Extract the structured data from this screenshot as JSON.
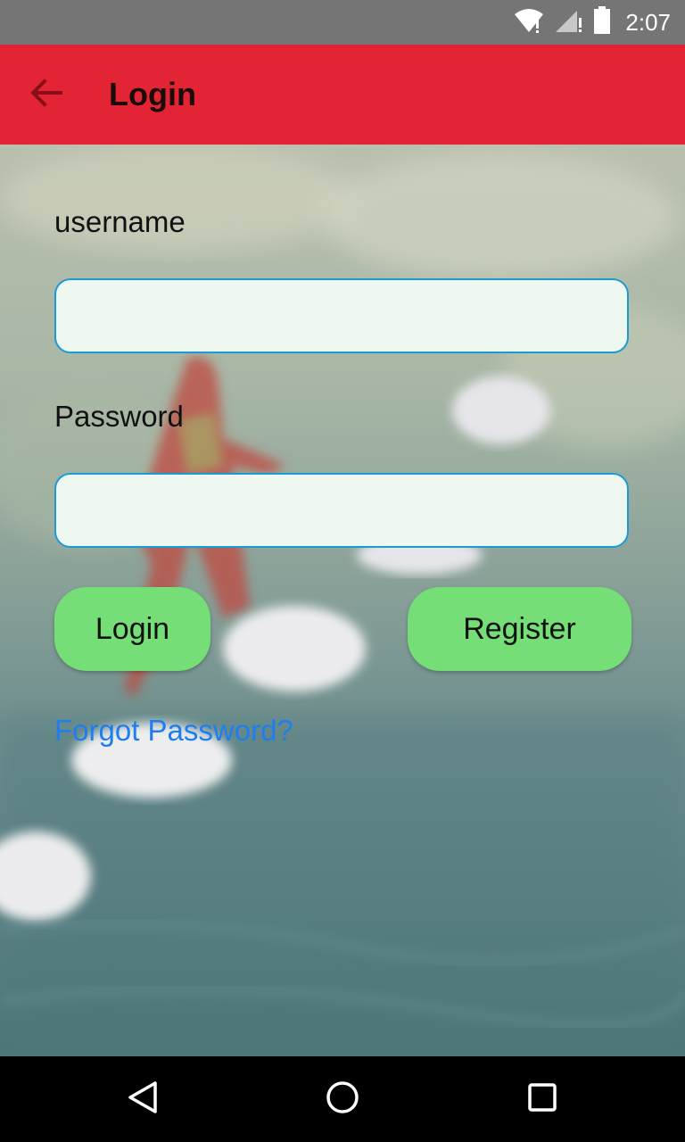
{
  "status_bar": {
    "time": "2:07",
    "icons": [
      "wifi-icon",
      "signal-icon",
      "battery-icon"
    ]
  },
  "app_bar": {
    "title": "Login",
    "back_icon": "arrow-back-icon"
  },
  "form": {
    "username_label": "username",
    "username_value": "",
    "password_label": "Password",
    "password_value": "",
    "login_button": "Login",
    "register_button": "Register",
    "forgot_link": "Forgot Password?"
  },
  "nav_bar": {
    "icons": [
      "back-triangle-icon",
      "home-circle-icon",
      "recents-square-icon"
    ]
  },
  "colors": {
    "status_bar": "#757575",
    "app_bar": "#e22434",
    "button": "#76de76",
    "field_border": "#1a9ad6",
    "field_bg": "#eef8f0",
    "link": "#1e7ef0"
  }
}
